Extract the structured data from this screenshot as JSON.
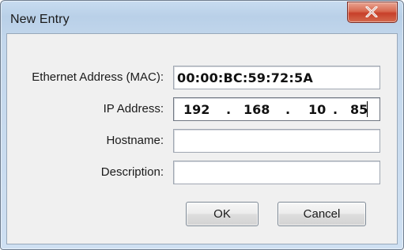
{
  "window": {
    "title": "New Entry"
  },
  "fields": {
    "mac": {
      "label": "Ethernet Address (MAC):",
      "value": "00:00:BC:59:72:5A"
    },
    "ip": {
      "label": "IP Address:",
      "octets": [
        "192",
        "168",
        "10",
        "85"
      ],
      "separator": "."
    },
    "hostname": {
      "label": "Hostname:",
      "value": ""
    },
    "description": {
      "label": "Description:",
      "value": ""
    }
  },
  "buttons": {
    "ok_label": "OK",
    "cancel_label": "Cancel"
  },
  "icons": {
    "close": "close-icon"
  },
  "colors": {
    "close_button": "#d04a32",
    "title_bar": "#bcd3ea",
    "client_background": "#f0f0f0"
  }
}
